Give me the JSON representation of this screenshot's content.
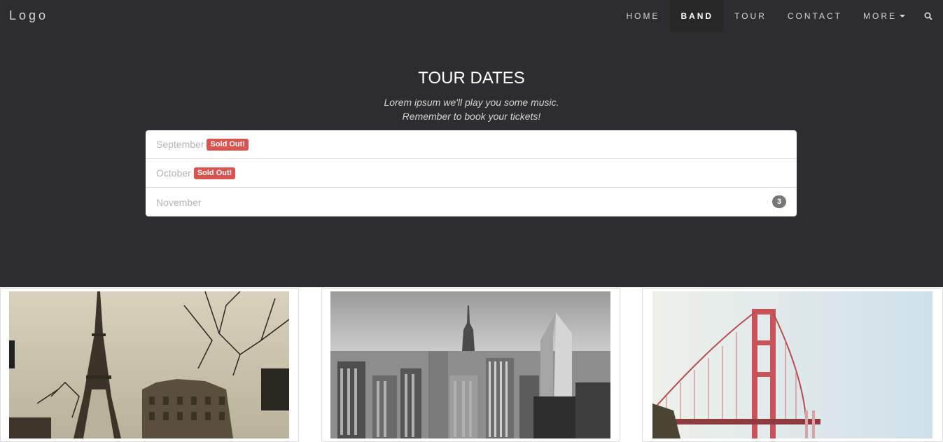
{
  "navbar": {
    "logo": "Logo",
    "items": [
      {
        "label": "HOME",
        "active": false
      },
      {
        "label": "BAND",
        "active": true
      },
      {
        "label": "TOUR",
        "active": false
      },
      {
        "label": "CONTACT",
        "active": false
      },
      {
        "label": "MORE",
        "active": false
      }
    ],
    "search_icon": "search-icon"
  },
  "hero": {
    "title": "TOUR DATES",
    "subtitle_line1": "Lorem ipsum we'll play you some music.",
    "subtitle_line2": "Remember to book your tickets!"
  },
  "tour_dates": [
    {
      "month": "September",
      "label": "Sold Out!"
    },
    {
      "month": "October",
      "label": "Sold Out!"
    },
    {
      "month": "November",
      "badge": "3"
    }
  ],
  "colors": {
    "dark_bg": "#2d2d30",
    "sold_out": "#d9534f",
    "badge": "#777777"
  },
  "thumbnails": [
    {
      "subject": "paris-eiffel-tower-image"
    },
    {
      "subject": "new-york-skyline-image"
    },
    {
      "subject": "san-francisco-bridge-image"
    }
  ]
}
